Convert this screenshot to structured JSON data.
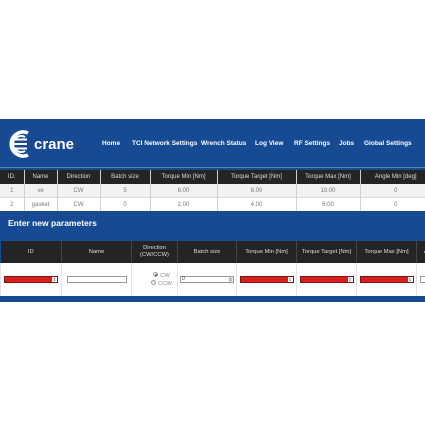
{
  "brand": {
    "name": "crane"
  },
  "nav": [
    "Home",
    "TCI Network Settings",
    "Wrench Status",
    "Log View",
    "RF Settings",
    "Jobs",
    "Global Settings"
  ],
  "params_table": {
    "headers": [
      "ID.",
      "Name",
      "Direction",
      "Batch size",
      "Torque Min [Nm]",
      "Torque Target [Nm]",
      "Torque Max [Nm]",
      "Angle Min [deg]"
    ],
    "rows": [
      [
        "1",
        "ve",
        "CW",
        "5",
        "6.00",
        "8.00",
        "10.00",
        "0"
      ],
      [
        "2",
        "gasket",
        "CW",
        "0",
        "2.00",
        "4.00",
        "6.00",
        "0"
      ]
    ]
  },
  "new_params": {
    "title": "Enter new parameters",
    "headers": [
      "ID",
      "Name",
      "Direction\n(CW/CCW)",
      "Batch size",
      "Torque Min [Nm]",
      "Torque Target [Nm]",
      "Torque Max [Nm]",
      "A"
    ],
    "direction_options": [
      "CW",
      "CCW"
    ],
    "direction_selected": "CW",
    "batch_value": "0",
    "name_value": ""
  },
  "colors": {
    "band": "#164a93",
    "header_bg": "#242424",
    "invalid_field": "#d42020"
  },
  "icons": [
    "crane-logo-icon",
    "spinner-arrows-icon"
  ]
}
